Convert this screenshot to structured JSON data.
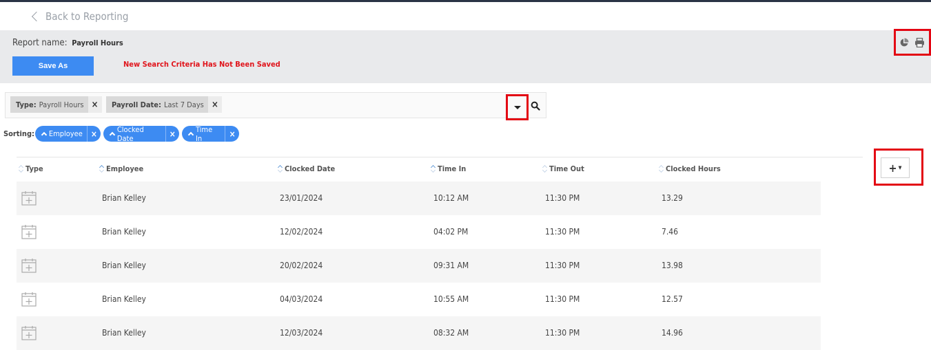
{
  "nav": {
    "back_label": "Back to Reporting"
  },
  "header": {
    "report_name_label": "Report name:",
    "report_name_value": "Payroll Hours",
    "save_as_label": "Save As",
    "unsaved_message": "New Search Criteria Has Not Been Saved",
    "icons": [
      "chart-icon",
      "print-icon"
    ]
  },
  "filters": {
    "chips": [
      {
        "key": "Type:",
        "value": "Payroll Hours",
        "remove": "×"
      },
      {
        "key": "Payroll Date:",
        "value": "Last 7 Days",
        "remove": "×"
      }
    ]
  },
  "sorting": {
    "label": "Sorting:",
    "pills": [
      {
        "label": "Employee",
        "remove": "×"
      },
      {
        "label": "Clocked Date",
        "remove": "×"
      },
      {
        "label": "Time In",
        "remove": "×"
      }
    ]
  },
  "table": {
    "add_column_label": "+",
    "columns": [
      "Type",
      "Employee",
      "Clocked Date",
      "Time In",
      "Time Out",
      "Clocked Hours"
    ],
    "rows": [
      {
        "type_icon": "calendar-plus-icon",
        "employee": "Brian Kelley",
        "clocked_date": "23/01/2024",
        "time_in": "10:12 AM",
        "time_out": "11:30 PM",
        "clocked_hours": "13.29"
      },
      {
        "type_icon": "calendar-plus-icon",
        "employee": "Brian Kelley",
        "clocked_date": "12/02/2024",
        "time_in": "04:02 PM",
        "time_out": "11:30 PM",
        "clocked_hours": "7.46"
      },
      {
        "type_icon": "calendar-plus-icon",
        "employee": "Brian Kelley",
        "clocked_date": "20/02/2024",
        "time_in": "09:31 AM",
        "time_out": "11:30 PM",
        "clocked_hours": "13.98"
      },
      {
        "type_icon": "calendar-plus-icon",
        "employee": "Brian Kelley",
        "clocked_date": "04/03/2024",
        "time_in": "10:55 AM",
        "time_out": "11:30 PM",
        "clocked_hours": "12.57"
      },
      {
        "type_icon": "calendar-plus-icon",
        "employee": "Brian Kelley",
        "clocked_date": "12/03/2024",
        "time_in": "08:32 AM",
        "time_out": "11:30 PM",
        "clocked_hours": "14.96"
      }
    ]
  },
  "colors": {
    "accent": "#3d8bf2",
    "warning": "#e0141b",
    "highlight_box": "#e30613"
  }
}
